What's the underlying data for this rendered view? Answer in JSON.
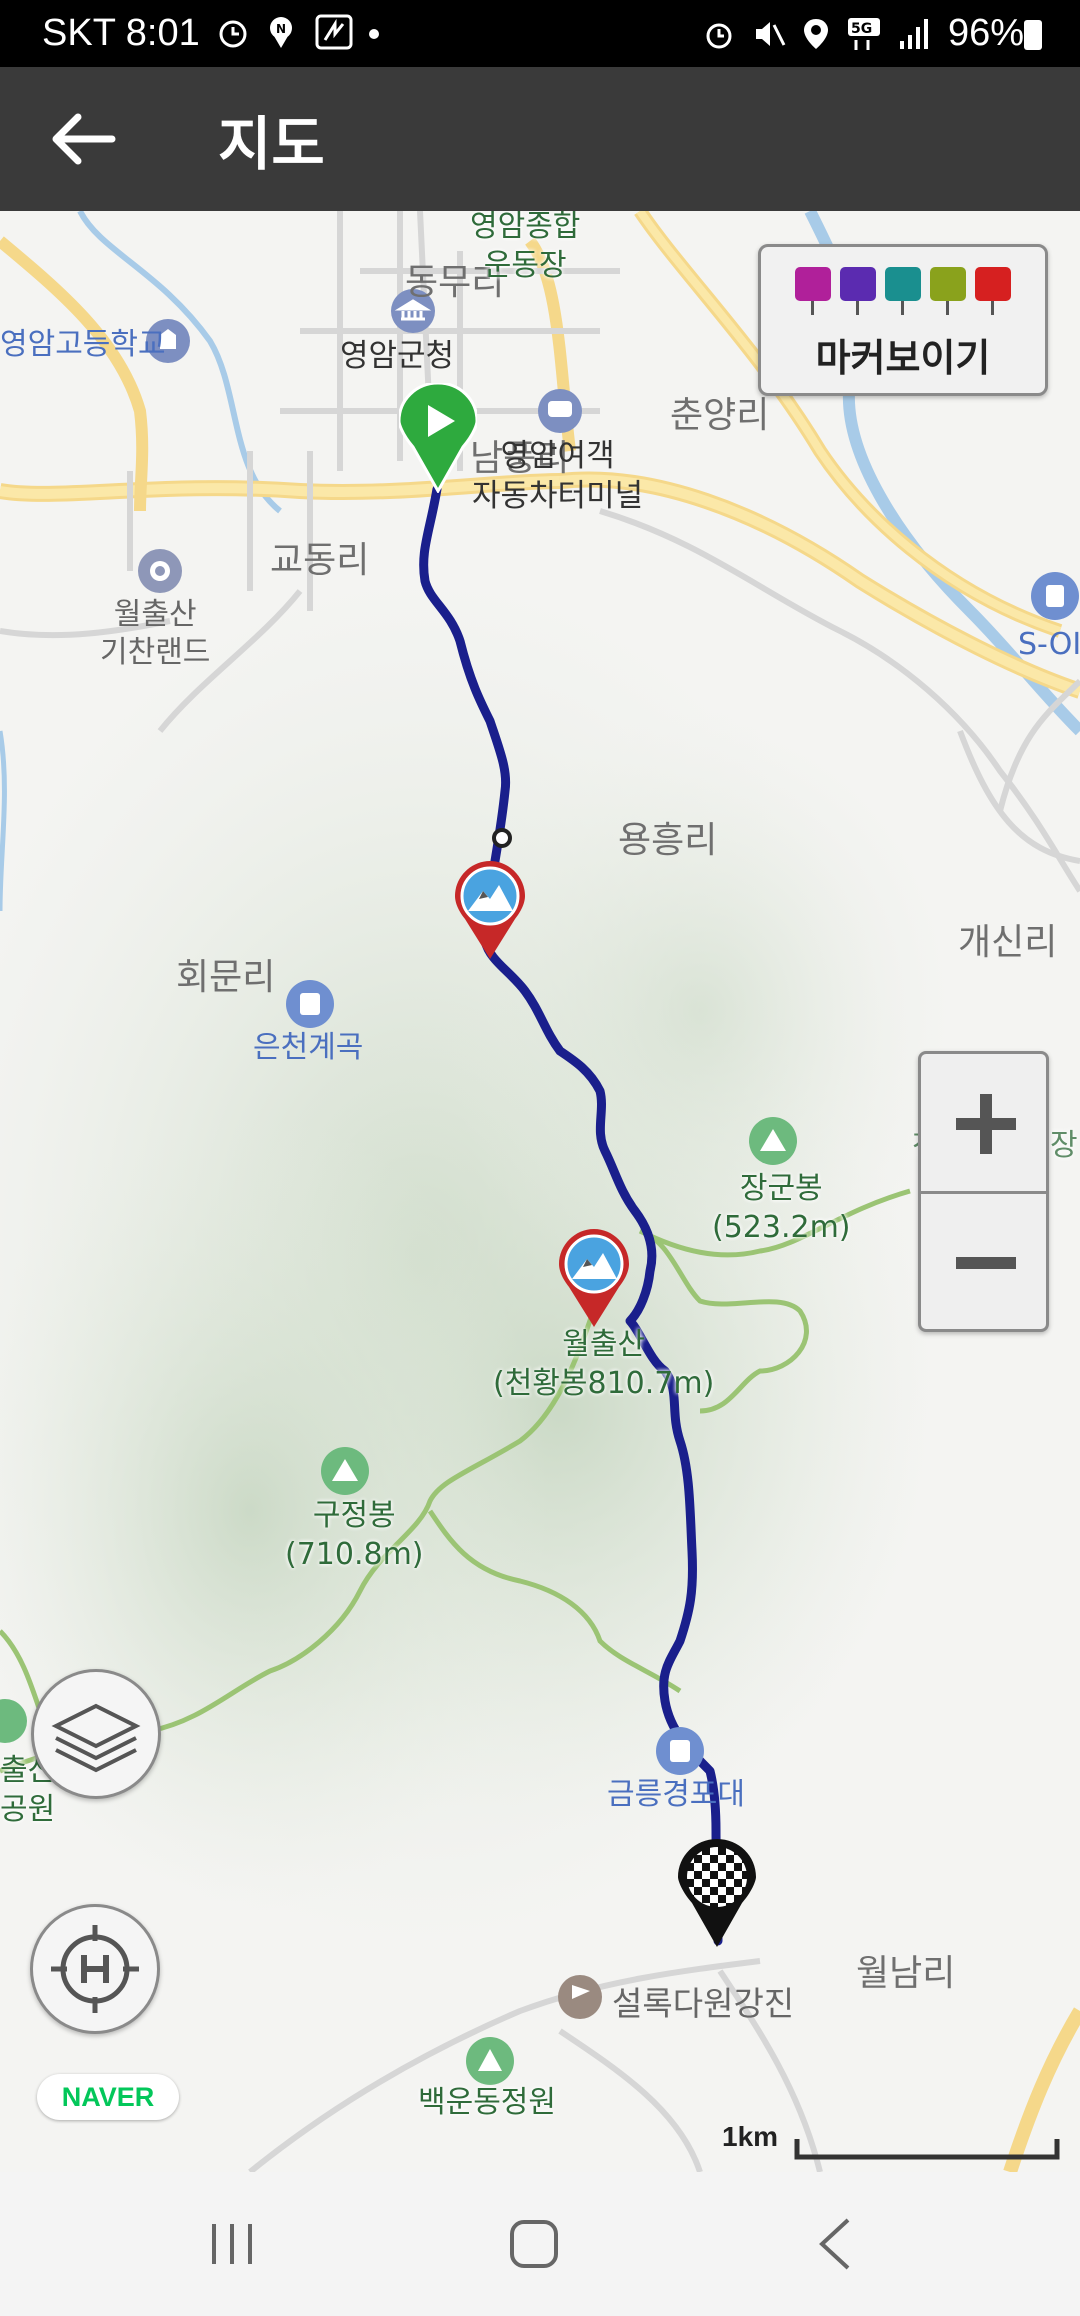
{
  "status_bar": {
    "carrier": "SKT",
    "time": "8:01",
    "battery": "96%",
    "network": "5G"
  },
  "app_bar": {
    "title": "지도",
    "back_icon": "arrow-left-icon"
  },
  "map": {
    "marker_toggle_label": "마커보이기",
    "marker_colors": [
      "#b0209a",
      "#5b2bb0",
      "#1a8f8f",
      "#8aa21c",
      "#d62020"
    ],
    "area_labels": {
      "dongmu": "동무리",
      "chunyang": "춘양리",
      "gyodong": "교동리",
      "yongheung": "용흥리",
      "gaesin": "개신리",
      "hoemun": "회문리",
      "wolnam": "월남리",
      "nampung": "남풍리"
    },
    "poi_labels": {
      "stadium_line1": "영암종합",
      "stadium_line2": "운동장",
      "county_office": "영암군청",
      "highschool": "영암고등학교",
      "terminal_line1": "영암여객",
      "terminal_line2": "자동차터미널",
      "gichan_line1": "월출산",
      "gichan_line2": "기찬랜드",
      "eunchen": "은천계곡",
      "camp": "천황사야영장",
      "geumneung": "금릉경포대",
      "seollok": "설록다원강진",
      "baekun": "백운동정원",
      "gas": "S-OI",
      "park_line1": "출산",
      "park_line2": "공원"
    },
    "peaks": {
      "janggun_name": "장군봉",
      "janggun_height": "(523.2m)",
      "wolchul_name": "월출산",
      "wolchul_height": "(천황봉810.7m)",
      "gujeong_name": "구정봉",
      "gujeong_height": "(710.8m)"
    },
    "scale_label": "1km",
    "provider": "NAVER",
    "route_color": "#1a1f8c",
    "start_marker_color": "#2eaa3e",
    "waypoint_marker_color": "#c62828"
  },
  "nav_bar": {
    "recents_icon": "recents-icon",
    "home_icon": "home-icon",
    "back_icon": "back-chevron-icon"
  }
}
